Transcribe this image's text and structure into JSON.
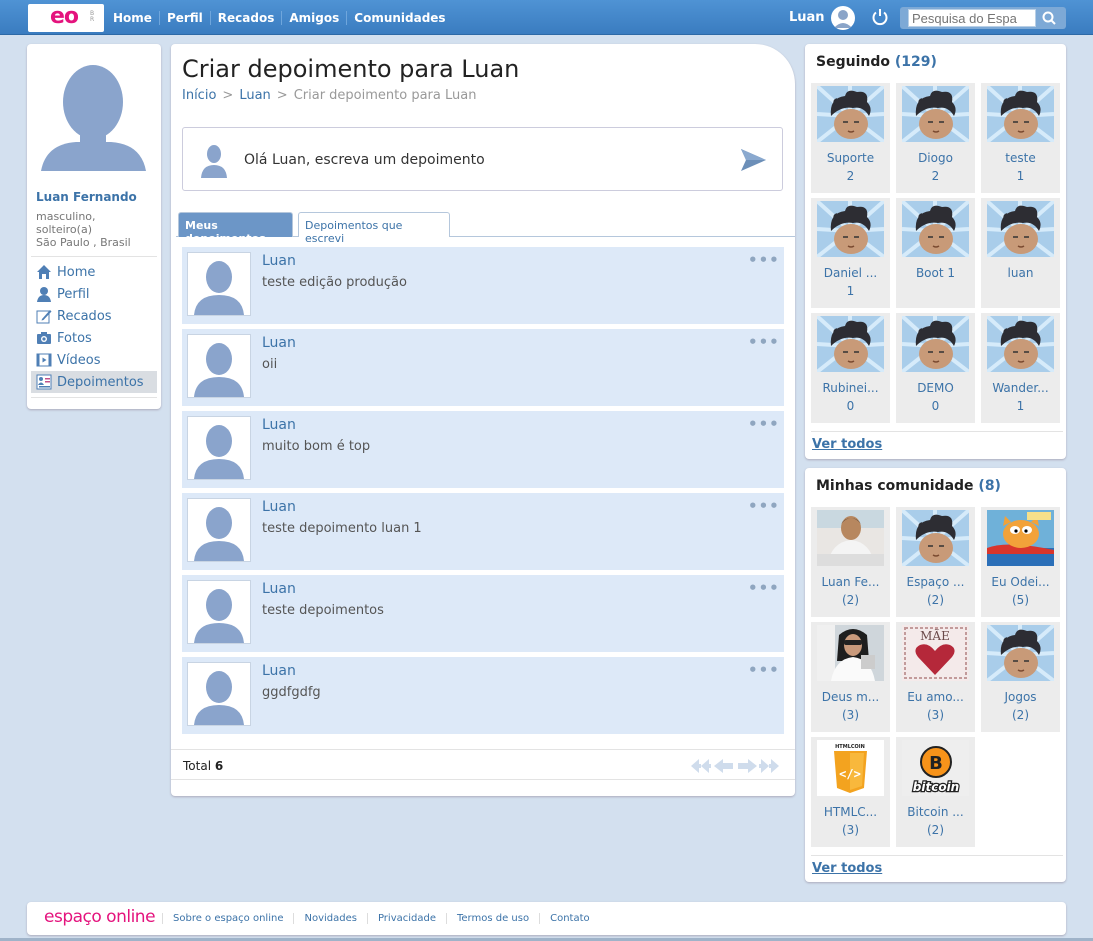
{
  "topbar": {
    "logo_text": "eo",
    "logo_sub": "BR",
    "nav": [
      "Home",
      "Perfil",
      "Recados",
      "Amigos",
      "Comunidades"
    ],
    "user_name": "Luan",
    "search_placeholder": "Pesquisa do Espa"
  },
  "profile": {
    "name": "Luan Fernando",
    "info_line1": "masculino,",
    "info_line2": "solteiro(a)",
    "info_line3": "São Paulo , Brasil",
    "menu": [
      {
        "label": "Home",
        "icon": "house-icon"
      },
      {
        "label": "Perfil",
        "icon": "person-icon"
      },
      {
        "label": "Recados",
        "icon": "pencil-icon"
      },
      {
        "label": "Fotos",
        "icon": "camera-icon"
      },
      {
        "label": "Vídeos",
        "icon": "film-icon"
      },
      {
        "label": "Depoimentos",
        "icon": "testimonial-icon",
        "active": true
      }
    ]
  },
  "main": {
    "title": "Criar depoimento para Luan",
    "breadcrumb": [
      "Início",
      "Luan",
      "Criar depoimento para Luan"
    ],
    "breadcrumb_sep": ">",
    "write_prompt": "Olá Luan, escreva um depoimento",
    "tabs": [
      "Meus depoimentos",
      "Depoimentos que escrevi"
    ],
    "items": [
      {
        "author": "Luan",
        "text": "teste edição produção"
      },
      {
        "author": "Luan",
        "text": "oii"
      },
      {
        "author": "Luan",
        "text": "muito bom é top"
      },
      {
        "author": "Luan",
        "text": "teste depoimento luan 1"
      },
      {
        "author": "Luan",
        "text": "teste depoimentos"
      },
      {
        "author": "Luan",
        "text": "ggdfgdfg"
      }
    ],
    "more_glyph": "•••",
    "total_label": "Total",
    "total_value": "6"
  },
  "following": {
    "title": "Seguindo",
    "count": "(129)",
    "people": [
      {
        "name": "Suporte",
        "count": "2"
      },
      {
        "name": "Diogo",
        "count": "2"
      },
      {
        "name": "teste",
        "count": "1"
      },
      {
        "name": "Daniel ...",
        "count": "1"
      },
      {
        "name": "Boot 1",
        "count": ""
      },
      {
        "name": "luan",
        "count": ""
      },
      {
        "name": "Rubinei...",
        "count": "0"
      },
      {
        "name": "DEMO",
        "count": "0"
      },
      {
        "name": "Wander...",
        "count": "1"
      }
    ],
    "see_all": "Ver todos"
  },
  "communities": {
    "title": "Minhas comunidade",
    "count": "(8)",
    "items": [
      {
        "name": "Luan Fe...",
        "count": "(2)",
        "thumb": "photo-man"
      },
      {
        "name": "Espaço ...",
        "count": "(2)",
        "thumb": "cartoon-face"
      },
      {
        "name": "Eu Odei...",
        "count": "(5)",
        "thumb": "garfield"
      },
      {
        "name": "Deus m...",
        "count": "(3)",
        "thumb": "photo-woman"
      },
      {
        "name": "Eu amo...",
        "count": "(3)",
        "thumb": "mae-heart"
      },
      {
        "name": "Jogos",
        "count": "(2)",
        "thumb": "cartoon-face"
      },
      {
        "name": "HTMLC...",
        "count": "(3)",
        "thumb": "html5-logo"
      },
      {
        "name": "Bitcoin ...",
        "count": "(2)",
        "thumb": "bitcoin-logo"
      }
    ],
    "see_all": "Ver todos",
    "mae_text": "MÃE",
    "html_badge": "HTMLCOIN",
    "html_glyph": "</>",
    "btc_glyph": "B",
    "btc_word": "bitcoin"
  },
  "footer": {
    "logo": "espaço online",
    "links": [
      "Sobre o espaço online",
      "Novidades",
      "Privacidade",
      "Termos de uso",
      "Contato"
    ]
  },
  "colors": {
    "brand_pink": "#e4137d",
    "link_blue": "#3c73a8",
    "topbar_blue": "#3a7cc0",
    "item_bg": "#dde9f8"
  }
}
